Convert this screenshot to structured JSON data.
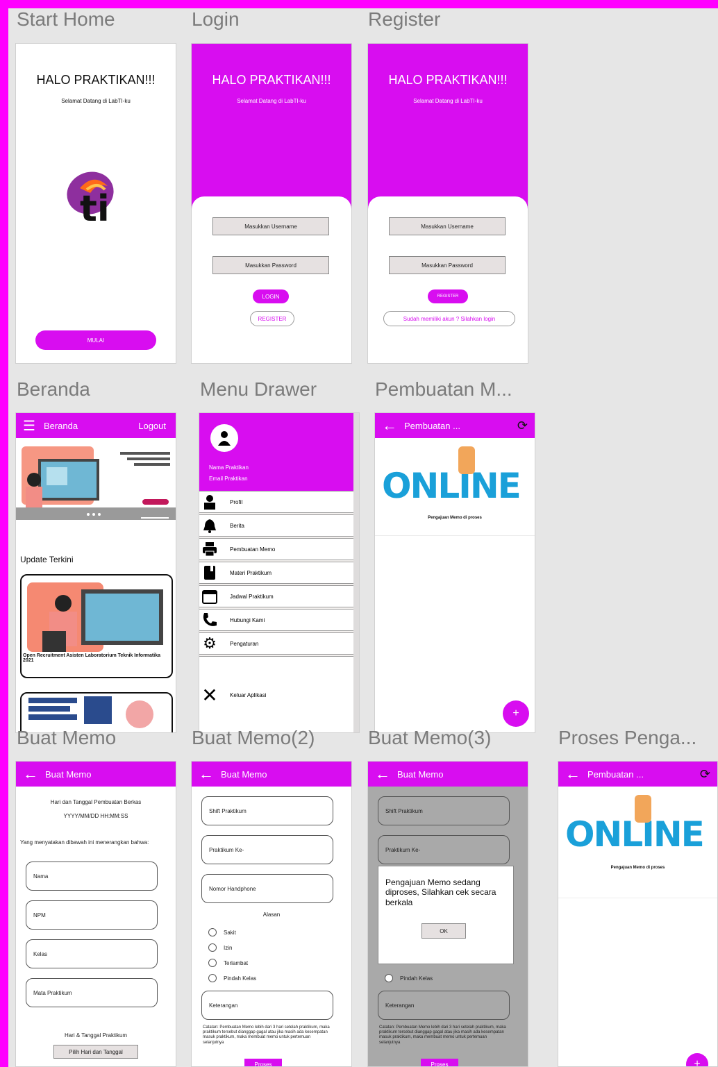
{
  "frames": {
    "start_home": "Start Home",
    "login": "Login",
    "register": "Register",
    "beranda": "Beranda",
    "menu_drawer": "Menu Drawer",
    "pembuatan": "Pembuatan M...",
    "buat_memo": "Buat Memo",
    "buat_memo2": "Buat Memo(2)",
    "buat_memo3": "Buat Memo(3)",
    "proses": "Proses Penga..."
  },
  "greeting": {
    "title": "HALO PRAKTIKAN!!!",
    "subtitle": "Selamat Datang di LabTI-ku"
  },
  "start": {
    "mulai": "MULAI",
    "logo_text": "ti"
  },
  "login": {
    "username": "Masukkan Username",
    "password": "Masukkan Password",
    "login_btn": "LOGIN",
    "register_btn": "REGISTER"
  },
  "register": {
    "username": "Masukkan Username",
    "password": "Masukkan Password",
    "register_btn": "REGISTER",
    "login_link": "Sudah memiliki akun ? Silahkan login"
  },
  "beranda": {
    "title": "Beranda",
    "logout": "Logout",
    "update_title": "Update Terkini",
    "card_title": "Open Recruitment Asisten Laboratorium Teknik Informatika 2021"
  },
  "drawer": {
    "name": "Nama Praktikan",
    "email": "Email Praktikan",
    "items": [
      "Profil",
      "Berita",
      "Pembuatan Memo",
      "Materi Praktikum",
      "Jadwal Praktikum",
      "Hubungi Kami",
      "Pengaturan"
    ],
    "exit": "Keluar Aplikasi"
  },
  "pembuatan": {
    "title": "Pembuatan ...",
    "online": "ONLINE",
    "caption": "Pengajuan Memo di proses",
    "fab": "+"
  },
  "memo": {
    "title": "Buat Memo",
    "date_label": "Hari dan Tanggal Pembuatan Berkas",
    "date_value": "YYYY/MM/DD HH:MM:SS",
    "statement": "Yang menyatakan dibawah ini menerangkan bahwa:",
    "fields": [
      "Nama",
      "NPM",
      "Kelas",
      "Mata Praktikum"
    ],
    "schedule_label": "Hari & Tanggal Praktikum",
    "schedule_btn": "Pilih Hari dan Tanggal"
  },
  "memo2": {
    "title": "Buat Memo",
    "fields": [
      "Shift Praktikum",
      "Praktikum Ke-",
      "Nomor Handphone"
    ],
    "reason_label": "Alasan",
    "reasons": [
      "Sakit",
      "Izin",
      "Terlambat",
      "Pindah Kelas"
    ],
    "note": "Keterangan",
    "caution": "Catatan: Pembuatan Memo lebih dari 3 hari setelah praktikum, maka praktikum tersebut dianggap gagal atau jika masih ada kesempatan masuk praktikum, maka membuat memo untuk pertemuan selanjutnya",
    "proses": "Proses"
  },
  "memo3": {
    "dialog": "Pengajuan Memo sedang diproses, Silahkan cek secara berkala",
    "ok": "OK",
    "reason_visible": "Pindah Kelas"
  }
}
